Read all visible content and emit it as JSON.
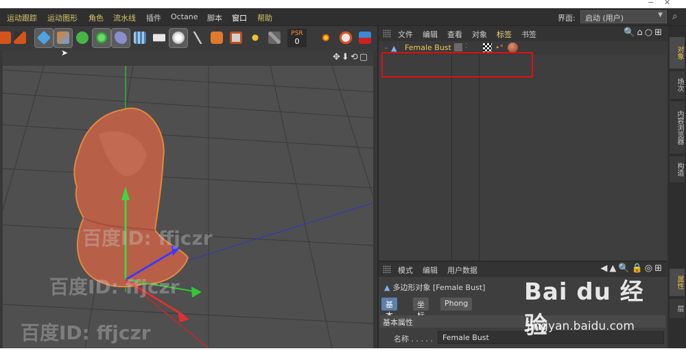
{
  "window_controls": [
    "−",
    "✕"
  ],
  "menu": {
    "items": [
      "运动跟踪",
      "运动图形",
      "角色",
      "流水线",
      "插件",
      "Octane",
      "脚本",
      "窗口",
      "帮助"
    ],
    "layout_label": "界面:",
    "layout_value": "启动 (用户)"
  },
  "toolbar": {
    "psr_label": "PSR",
    "psr_value": "0"
  },
  "viewport": {
    "nav_icons": "✥⬇⟲▢",
    "watermark_text": "百度ID: ffjczr"
  },
  "object_manager": {
    "menus": [
      "文件",
      "编辑",
      "查看",
      "对象",
      "标签",
      "书签"
    ],
    "active_menu": "标签",
    "icons": "🔍⌂○⊞",
    "object_name": "Female Bust"
  },
  "side_tabs": [
    "对象",
    "场次",
    "内容浏览器",
    "构造",
    "属性",
    "层"
  ],
  "attributes": {
    "menus": [
      "模式",
      "编辑",
      "用户数据"
    ],
    "icons": "◀▲🔍🔒◎⊞",
    "title": "多边形对象 [Female Bust]",
    "tabs": [
      "基本",
      "坐标",
      "Phong"
    ],
    "active_tab": "基本",
    "section": "基本属性",
    "field_label": "名称 . . . . .",
    "field_value": "Female Bust"
  },
  "baidu": {
    "logo": "Bai du 经验",
    "url": "jingyan.baidu.com"
  }
}
